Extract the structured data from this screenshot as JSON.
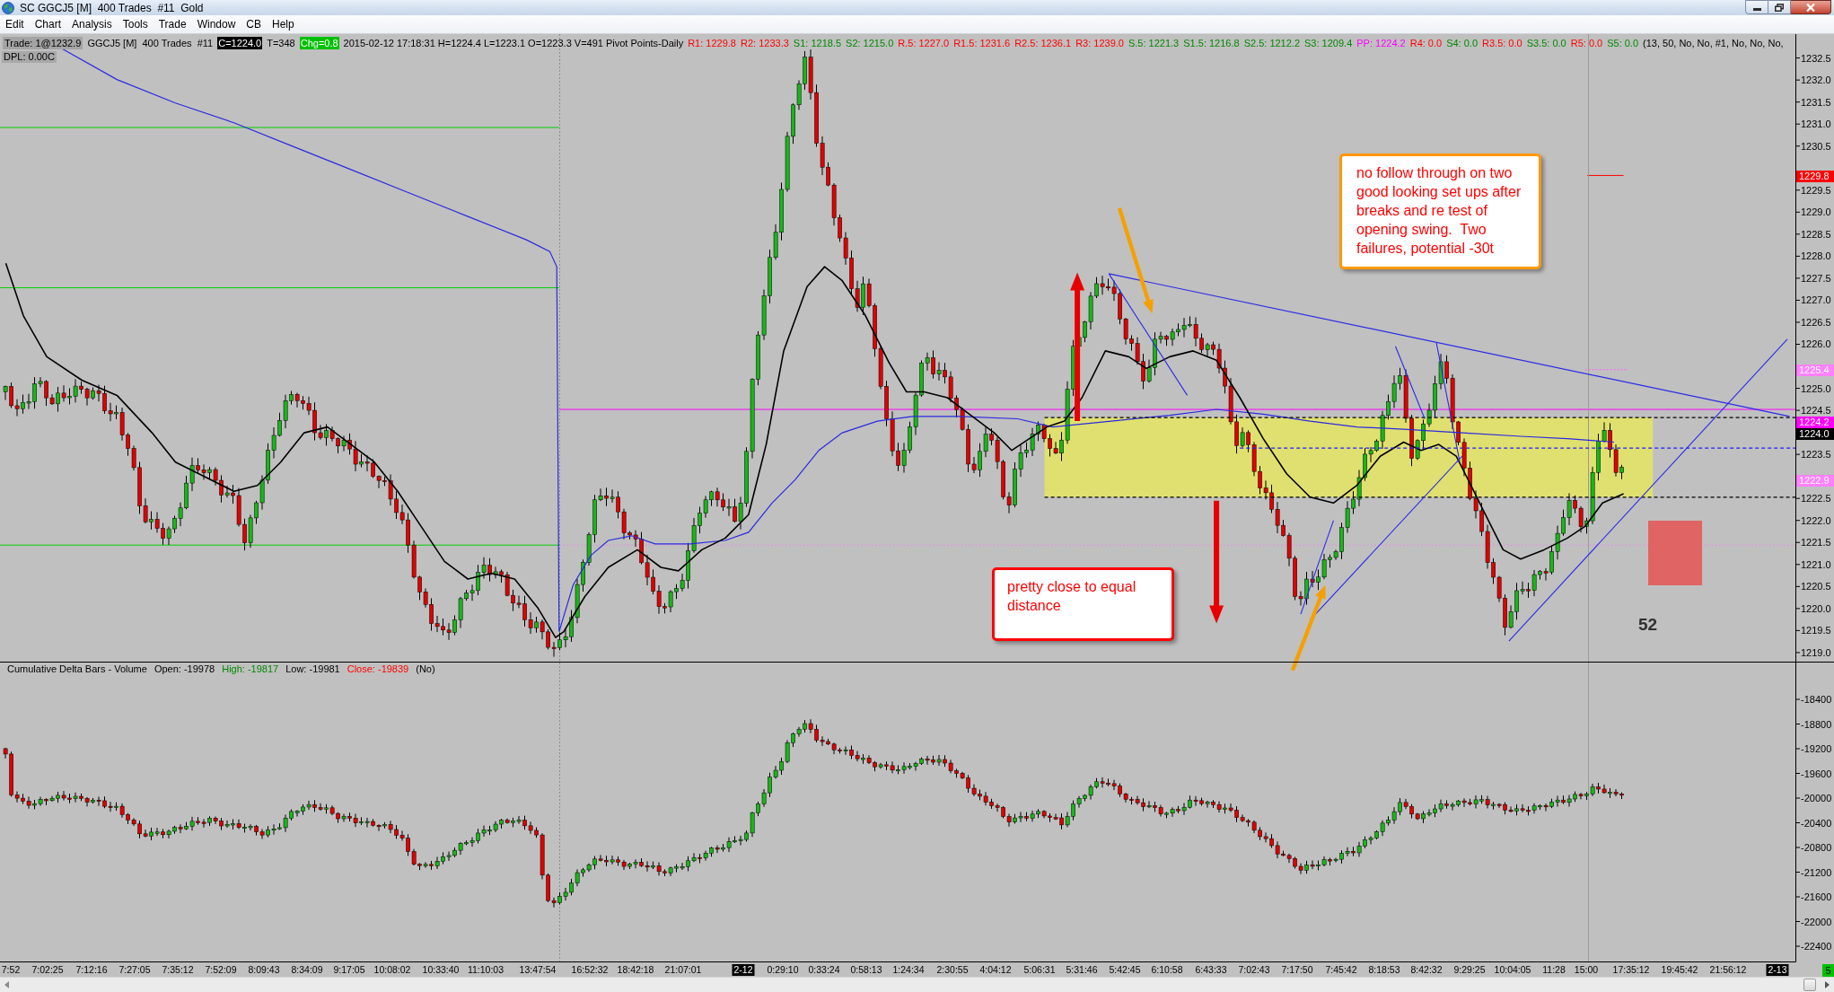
{
  "window": {
    "title": "SC GGCJ5 [M]  400 Trades  #11  Gold"
  },
  "menu": [
    "Edit",
    "Chart",
    "Analysis",
    "Tools",
    "Trade",
    "Window",
    "CB",
    "Help"
  ],
  "chart": {
    "info_line": [
      {
        "text": "Trade: 1@1232.9",
        "kind": "badge"
      },
      {
        "text": "GGCJ5 [M]  400 Trades  #11",
        "kind": "plain"
      },
      {
        "text": "C=1224.0",
        "kind": "inverse"
      },
      {
        "text": "T=348",
        "kind": "plain"
      },
      {
        "text": "Chg=0.8",
        "kind": "change"
      },
      {
        "text": "2015-02-12 17:18:31 H=1224.4 L=1223.1 O=1223.3 V=491 Pivot Points-Daily",
        "kind": "plain"
      },
      {
        "text": "R1: 1229.8",
        "kind": "resistance"
      },
      {
        "text": "R2: 1233.3",
        "kind": "resistance"
      },
      {
        "text": "S1: 1218.5",
        "kind": "support"
      },
      {
        "text": "S2: 1215.0",
        "kind": "support"
      },
      {
        "text": "R.5: 1227.0",
        "kind": "resistance"
      },
      {
        "text": "R1.5: 1231.6",
        "kind": "resistance"
      },
      {
        "text": "R2.5: 1236.1",
        "kind": "resistance"
      },
      {
        "text": "R3: 1239.0",
        "kind": "resistance"
      },
      {
        "text": "S.5: 1221.3",
        "kind": "support"
      },
      {
        "text": "S1.5: 1216.8",
        "kind": "support"
      },
      {
        "text": "S2.5: 1212.2",
        "kind": "support"
      },
      {
        "text": "S3: 1209.4",
        "kind": "support"
      },
      {
        "text": "PP: 1224.2",
        "kind": "pivot"
      },
      {
        "text": "R4: 0.0",
        "kind": "resistance"
      },
      {
        "text": "S4: 0.0",
        "kind": "support"
      },
      {
        "text": "R3.5: 0.0",
        "kind": "resistance"
      },
      {
        "text": "S3.5: 0.0",
        "kind": "support"
      },
      {
        "text": "R5: 0.0",
        "kind": "resistance"
      },
      {
        "text": "S5: 0.0",
        "kind": "support"
      },
      {
        "text": "(13, 50, No, No, #1, No, No, No,",
        "kind": "plain"
      }
    ],
    "dpl": "DPL: 0.00C",
    "price_labels": [
      "1232.5",
      "1232.0",
      "1231.5",
      "1231.0",
      "1230.5",
      "1229.5",
      "1229.0",
      "1228.5",
      "1228.0",
      "1227.5",
      "1227.0",
      "1226.5",
      "1226.0",
      "1225.0",
      "1224.5",
      "1223.5",
      "1222.5",
      "1222.0",
      "1221.5",
      "1221.0",
      "1220.5",
      "1220.0",
      "1219.5",
      "1219.0"
    ],
    "price_tags": [
      {
        "text": "1229.8",
        "color": "#ff0000"
      },
      {
        "text": "1225.4",
        "color": "#ff80ff"
      },
      {
        "text": "1224.2",
        "color": "#ff00ff"
      },
      {
        "text": "1224.0",
        "color": "#000000"
      },
      {
        "text": "1222.9",
        "color": "#ff80ff"
      }
    ],
    "annotations": [
      {
        "text": "no follow through on two good looking set ups after breaks and re test of opening swing.  Two failures, potential -30t",
        "color": "#ff9900"
      },
      {
        "text": "pretty close to equal distance",
        "color": "#ff0000"
      }
    ],
    "count_label": "52"
  },
  "delta_panel": {
    "legend": [
      {
        "text": "Cumulative Delta Bars - Volume",
        "kind": "plain"
      },
      {
        "text": "Open: -19978",
        "kind": "plain"
      },
      {
        "text": "High: -19817",
        "kind": "high"
      },
      {
        "text": "Low: -19981",
        "kind": "plain"
      },
      {
        "text": "Close: -19839",
        "kind": "close"
      },
      {
        "text": "(No)",
        "kind": "plain"
      }
    ],
    "labels": [
      "-18400",
      "-18800",
      "-19200",
      "-19600",
      "-20000",
      "-20400",
      "-20800",
      "-21200",
      "-21600",
      "-22000",
      "-22400"
    ]
  },
  "time_axis": {
    "labels": [
      {
        "text": "7:52",
        "kind": "time"
      },
      {
        "text": "7:02:25",
        "kind": "time"
      },
      {
        "text": "7:12:16",
        "kind": "time"
      },
      {
        "text": "7:27:05",
        "kind": "time"
      },
      {
        "text": "7:35:12",
        "kind": "time"
      },
      {
        "text": "7:52:09",
        "kind": "time"
      },
      {
        "text": "8:09:43",
        "kind": "time"
      },
      {
        "text": "8:34:09",
        "kind": "time"
      },
      {
        "text": "9:17:05",
        "kind": "time"
      },
      {
        "text": "10:08:02",
        "kind": "time"
      },
      {
        "text": "10:33:40",
        "kind": "time"
      },
      {
        "text": "11:10:03",
        "kind": "time"
      },
      {
        "text": "13:47:54",
        "kind": "time"
      },
      {
        "text": "16:52:32",
        "kind": "time"
      },
      {
        "text": "18:42:18",
        "kind": "time"
      },
      {
        "text": "21:07:01",
        "kind": "time"
      },
      {
        "text": "2-12",
        "kind": "date"
      },
      {
        "text": "0:29:10",
        "kind": "time"
      },
      {
        "text": "0:33:24",
        "kind": "time"
      },
      {
        "text": "0:58:13",
        "kind": "time"
      },
      {
        "text": "1:24:34",
        "kind": "time"
      },
      {
        "text": "2:30:55",
        "kind": "time"
      },
      {
        "text": "4:04:12",
        "kind": "time"
      },
      {
        "text": "5:06:31",
        "kind": "time"
      },
      {
        "text": "5:31:46",
        "kind": "time"
      },
      {
        "text": "5:42:45",
        "kind": "time"
      },
      {
        "text": "6:10:58",
        "kind": "time"
      },
      {
        "text": "6:43:33",
        "kind": "time"
      },
      {
        "text": "7:02:43",
        "kind": "time"
      },
      {
        "text": "7:17:50",
        "kind": "time"
      },
      {
        "text": "7:45:42",
        "kind": "time"
      },
      {
        "text": "8:18:53",
        "kind": "time"
      },
      {
        "text": "8:42:32",
        "kind": "time"
      },
      {
        "text": "9:29:25",
        "kind": "time"
      },
      {
        "text": "10:04:05",
        "kind": "time"
      },
      {
        "text": "11:28",
        "kind": "time"
      },
      {
        "text": "15:00",
        "kind": "time"
      },
      {
        "text": "17:35:12",
        "kind": "time"
      },
      {
        "text": "19:45:42",
        "kind": "time"
      },
      {
        "text": "21:56:12",
        "kind": "time"
      },
      {
        "text": "2-13",
        "kind": "date"
      }
    ],
    "status_badge": "5"
  }
}
